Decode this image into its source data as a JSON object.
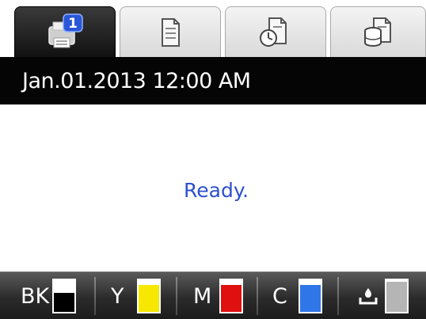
{
  "tabs": [
    {
      "icon": "printer-status-icon",
      "badge": "1",
      "active": true
    },
    {
      "icon": "document-icon",
      "active": false
    },
    {
      "icon": "document-clock-icon",
      "active": false
    },
    {
      "icon": "document-stack-icon",
      "active": false
    }
  ],
  "status": {
    "datetime": "Jan.01.2013 12:00 AM",
    "message": "Ready."
  },
  "ink": [
    {
      "label": "BK",
      "color": "#000000",
      "level": 0.6
    },
    {
      "label": "Y",
      "color": "#f6e800",
      "level": 0.85
    },
    {
      "label": "M",
      "color": "#e01010",
      "level": 0.85
    },
    {
      "label": "C",
      "color": "#2f76e8",
      "level": 0.85
    },
    {
      "label": "",
      "icon": "maintenance-box-icon",
      "color": "#b5b5b5",
      "level": 0.95
    }
  ]
}
